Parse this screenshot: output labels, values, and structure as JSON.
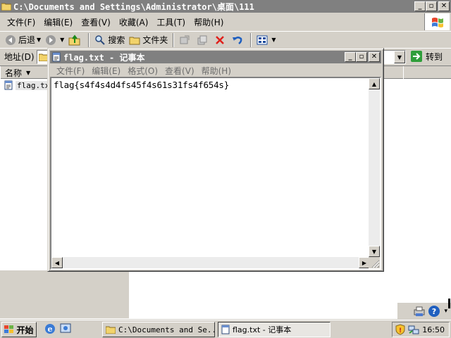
{
  "explorer": {
    "title": "C:\\Documents and Settings\\Administrator\\桌面\\111",
    "menu": [
      "文件(F)",
      "编辑(E)",
      "查看(V)",
      "收藏(A)",
      "工具(T)",
      "帮助(H)"
    ],
    "toolbar": {
      "back_label": "后退",
      "search_label": "搜索",
      "folders_label": "文件夹"
    },
    "address": {
      "label": "地址(D)",
      "go_label": "转到"
    },
    "columns": {
      "name": "名称"
    },
    "files": [
      {
        "name": "flag.txt"
      }
    ]
  },
  "notepad": {
    "title": "flag.txt - 记事本",
    "menu": [
      "文件(F)",
      "编辑(E)",
      "格式(O)",
      "查看(V)",
      "帮助(H)"
    ],
    "content": "flag{s4f4s4d4fs45f4s61s31fs4f654s}"
  },
  "taskbar": {
    "start_label": "开始",
    "tasks": [
      {
        "label": "C:\\Documents and Se..."
      },
      {
        "label": "flag.txt - 记事本"
      }
    ],
    "clock": "16:50"
  },
  "colors": {
    "titlebar_inactive": "#808080",
    "face": "#d4d0c8"
  }
}
